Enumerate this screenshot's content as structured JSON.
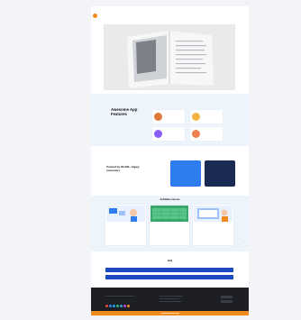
{
  "header": {
    "brand": "",
    "nav": [
      "",
      "",
      ""
    ]
  },
  "hero": {
    "image": "open-book-photo"
  },
  "features": {
    "title": "Awesome App Features",
    "subtitle": "",
    "items": [
      {
        "title": "",
        "desc": "",
        "color": "#e07a3a"
      },
      {
        "title": "",
        "desc": "",
        "color": "#f2b441"
      },
      {
        "title": "",
        "desc": "",
        "color": "#8b5cf6"
      },
      {
        "title": "",
        "desc": "",
        "color": "#f07f4f"
      }
    ]
  },
  "trusted": {
    "title": "Trusted by 30,000+ happy customers",
    "desc": "",
    "stats": [
      {
        "value": "",
        "label": "",
        "color": "#2e7df0"
      },
      {
        "value": "",
        "label": "",
        "color": "#1b2a55"
      }
    ]
  },
  "courses": {
    "title": "Available courses",
    "items": [
      {
        "title": ""
      },
      {
        "title": ""
      },
      {
        "title": ""
      }
    ]
  },
  "faq": {
    "title": "FAQ",
    "questions": [
      "",
      ""
    ]
  },
  "footer": {
    "about": "",
    "links": "",
    "apps": "",
    "social_colors": [
      "#e64a3a",
      "#2e7df0",
      "#18a0f0",
      "#34b36b",
      "#2ea6d8",
      "#c04bd8",
      "#f08a1c"
    ]
  },
  "colors": {
    "accent": "#f08a1c",
    "primary": "#1c49c2",
    "dark": "#1d1f24"
  }
}
